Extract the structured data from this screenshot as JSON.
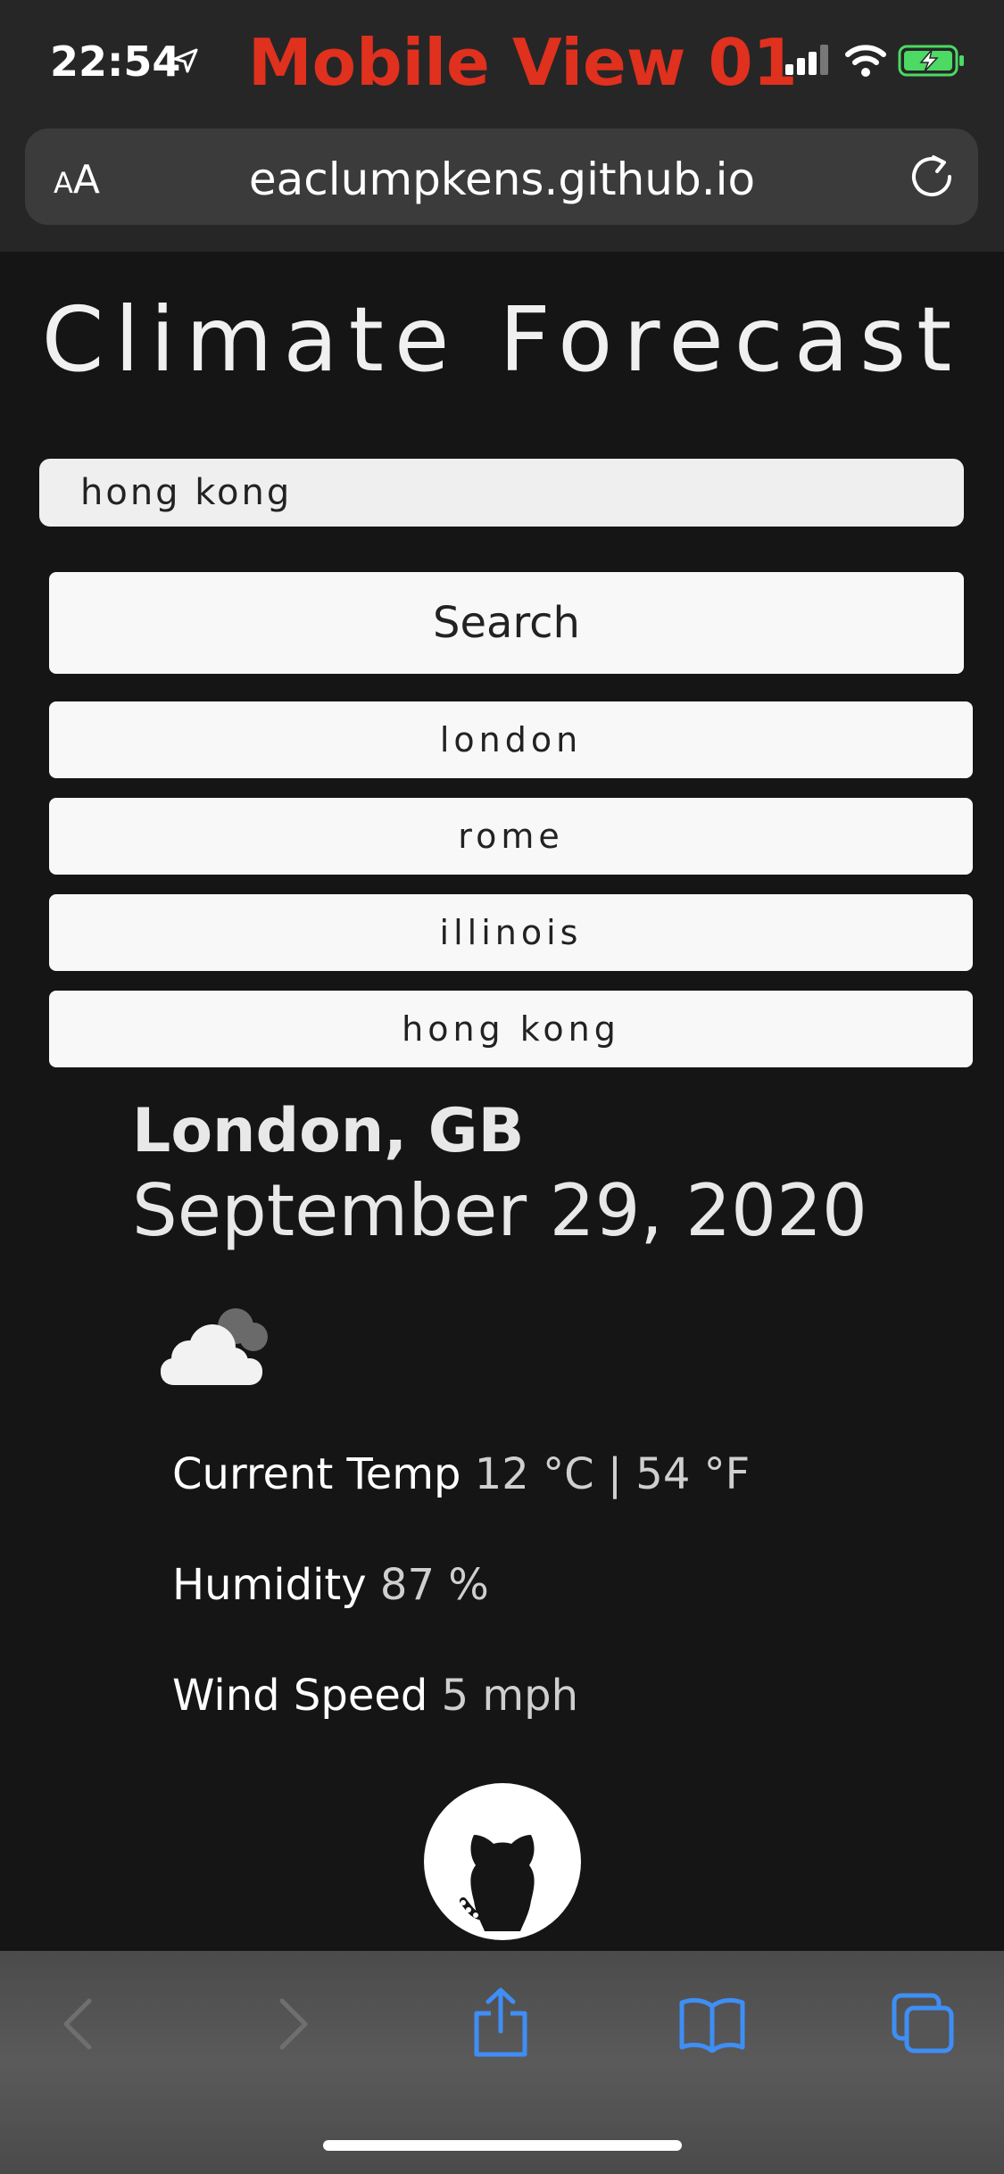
{
  "status_bar": {
    "time": "22:54",
    "overlay_title": "Mobile View 01"
  },
  "browser": {
    "text_size_label_small": "A",
    "text_size_label_big": "A",
    "url": "eaclumpkens.github.io"
  },
  "page": {
    "title": "Climate Forecast",
    "search": {
      "value": "hong kong",
      "button_label": "Search"
    },
    "history": [
      "london",
      "rome",
      "illinois",
      "hong kong"
    ],
    "forecast": {
      "city": "London, GB",
      "date": "September 29, 2020",
      "icon": "cloud-icon",
      "stats": [
        {
          "label": "Current Temp",
          "value": "12 °C | 54 °F"
        },
        {
          "label": "Humidity",
          "value": "87 %"
        },
        {
          "label": "Wind Speed",
          "value": "5 mph"
        }
      ]
    }
  },
  "colors": {
    "overlay_title": "#e0301e",
    "battery": "#4cd964",
    "toolbar_icon_active": "#3f8ef5"
  }
}
